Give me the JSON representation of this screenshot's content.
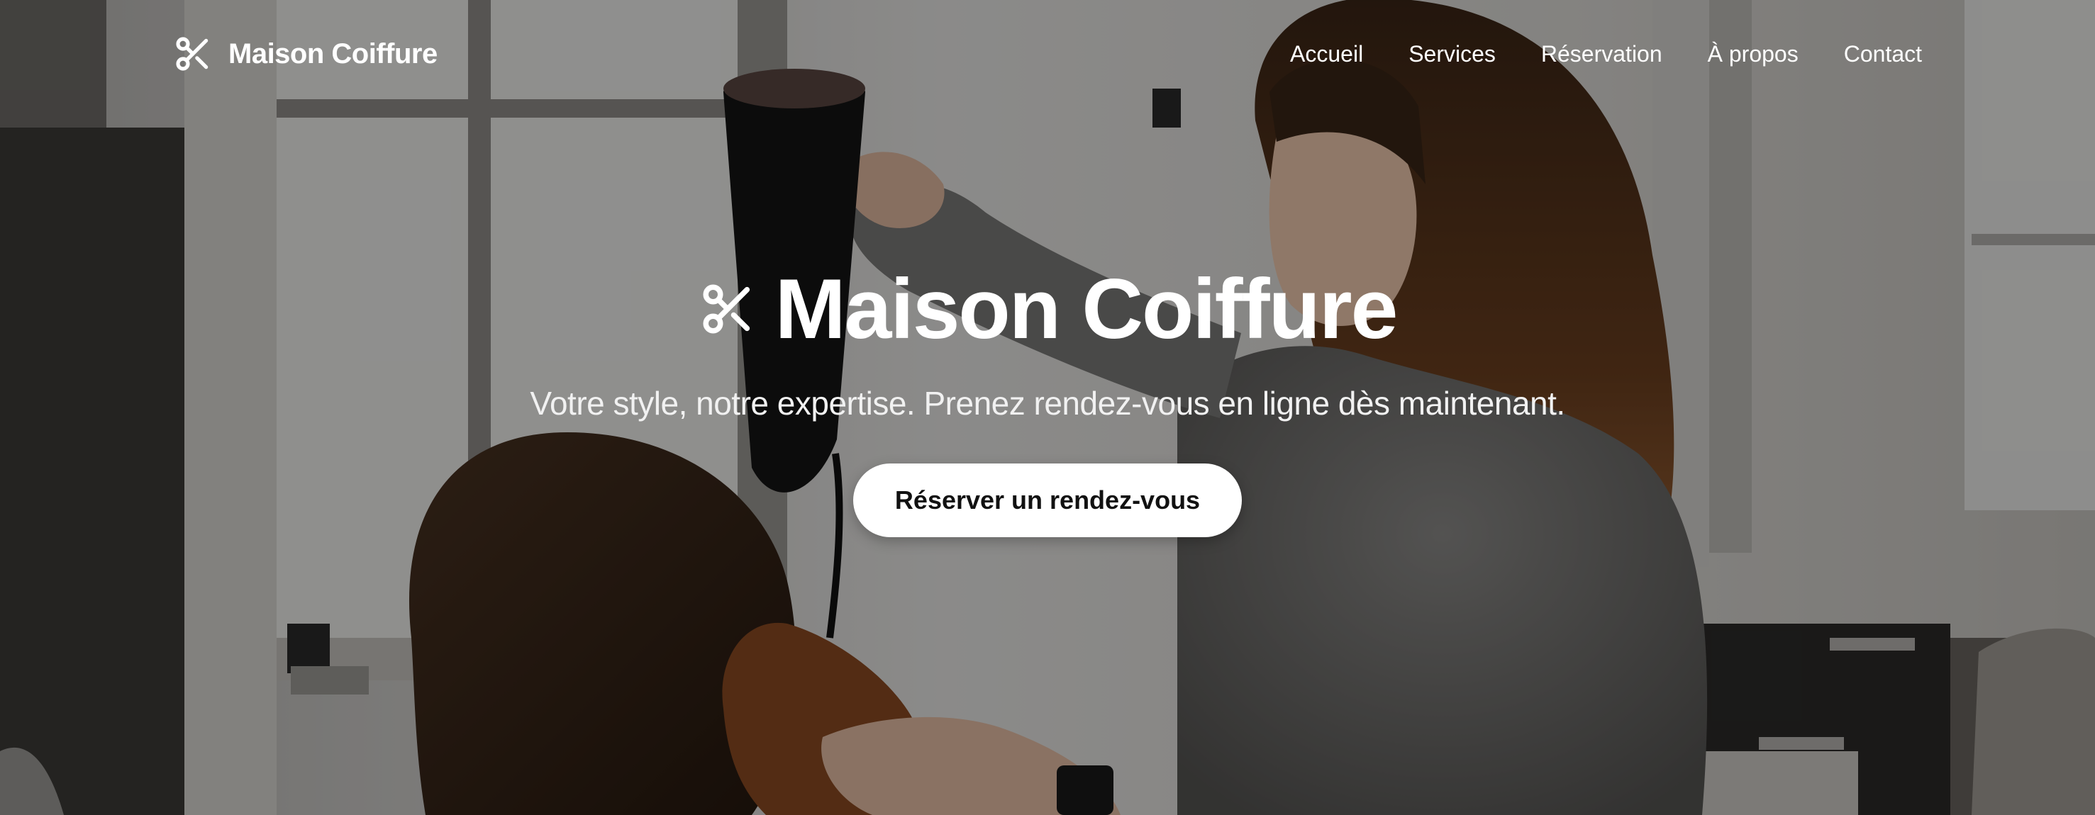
{
  "brand": {
    "name": "Maison Coiffure",
    "icon": "scissors-icon"
  },
  "nav": {
    "items": [
      {
        "label": "Accueil"
      },
      {
        "label": "Services"
      },
      {
        "label": "Réservation"
      },
      {
        "label": "À propos"
      },
      {
        "label": "Contact"
      }
    ]
  },
  "hero": {
    "title": "Maison Coiffure",
    "title_icon": "scissors-icon",
    "subtitle": "Votre style, notre expertise. Prenez rendez-vous en ligne dès maintenant.",
    "cta_label": "Réserver un rendez-vous",
    "background": "photo-hairdresser-blow-drying-client"
  },
  "colors": {
    "text": "#ffffff",
    "cta_background": "#ffffff",
    "cta_text": "#111111",
    "overlay": "rgba(0,0,0,0.40)"
  }
}
